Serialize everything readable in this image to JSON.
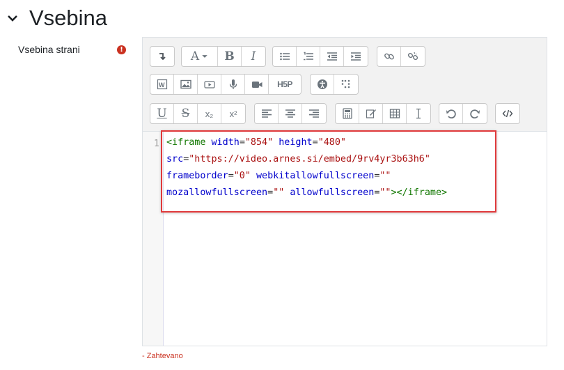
{
  "section": {
    "title": "Vsebina"
  },
  "field": {
    "label": "Vsebina strani",
    "required_icon": "!"
  },
  "toolbar": {
    "row1": [
      "↵",
      "A",
      "B",
      "I"
    ],
    "subscript": "x₂",
    "superscript": "x²",
    "h5p": "H5P",
    "underline": "U",
    "strike": "S"
  },
  "editor": {
    "line_number": "1",
    "code": {
      "l1_tag_open": "<iframe",
      "l1_a1": "width",
      "l1_v1": "\"854\"",
      "l1_a2": "height",
      "l1_v2": "\"480\"",
      "l2_a1": "src",
      "l2_v1": "\"https://video.arnes.si/embed/9rv4yr3b63h6\"",
      "l3_a1": "frameborder",
      "l3_v1": "\"0\"",
      "l3_a2": "webkitallowfullscreen",
      "l3_v2": "\"\"",
      "l4_a1": "mozallowfullscreen",
      "l4_v1": "\"\"",
      "l4_a2": "allowfullscreen",
      "l4_v2": "\"\"",
      "l4_close": "></iframe>"
    }
  },
  "required_note": "- Zahtevano",
  "colors": {
    "required": "#ca3120",
    "highlight": "#e0393b",
    "tag": "#117700",
    "attr": "#0000cc",
    "string": "#aa1111"
  }
}
